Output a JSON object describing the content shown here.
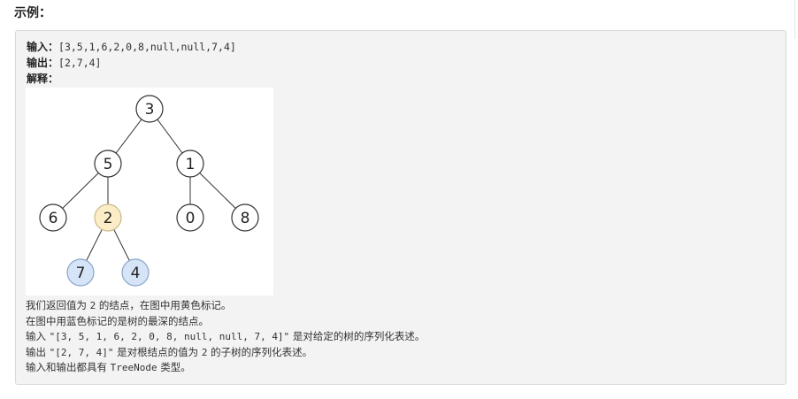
{
  "page": {
    "heading": "示例："
  },
  "example": {
    "input_label": "输入：",
    "input_value": "[3,5,1,6,2,0,8,null,null,7,4]",
    "output_label": "输出：",
    "output_value": "[2,7,4]",
    "explain_label": "解释："
  },
  "tree": {
    "nodes": [
      {
        "label": "3"
      },
      {
        "label": "5"
      },
      {
        "label": "1"
      },
      {
        "label": "6"
      },
      {
        "label": "2",
        "highlight": "yellow"
      },
      {
        "label": "0"
      },
      {
        "label": "8"
      },
      {
        "label": "7",
        "highlight": "blue"
      },
      {
        "label": "4",
        "highlight": "blue"
      }
    ],
    "colors": {
      "yellow_fill": "#fbeec7",
      "yellow_stroke": "#c9b98c",
      "blue_fill": "#d5e4f7",
      "blue_stroke": "#8aa6c9"
    }
  },
  "explanation": {
    "l1_a": "我们返回值为 ",
    "l1_code": "2",
    "l1_b": " 的结点，在图中用黄色标记。",
    "l2": "在图中用蓝色标记的是树的最深的结点。",
    "l3_a": "输入 ",
    "l3_code": "\"[3, 5, 1, 6, 2, 0, 8, null, null, 7, 4]\"",
    "l3_b": " 是对给定的树的序列化表述。",
    "l4_a": "输出 ",
    "l4_code": "\"[2, 7, 4]\"",
    "l4_b": " 是对根结点的值为 ",
    "l4_code2": "2",
    "l4_c": " 的子树的序列化表述。",
    "l5_a": "输入和输出都具有 ",
    "l5_code": "TreeNode",
    "l5_b": " 类型。"
  }
}
